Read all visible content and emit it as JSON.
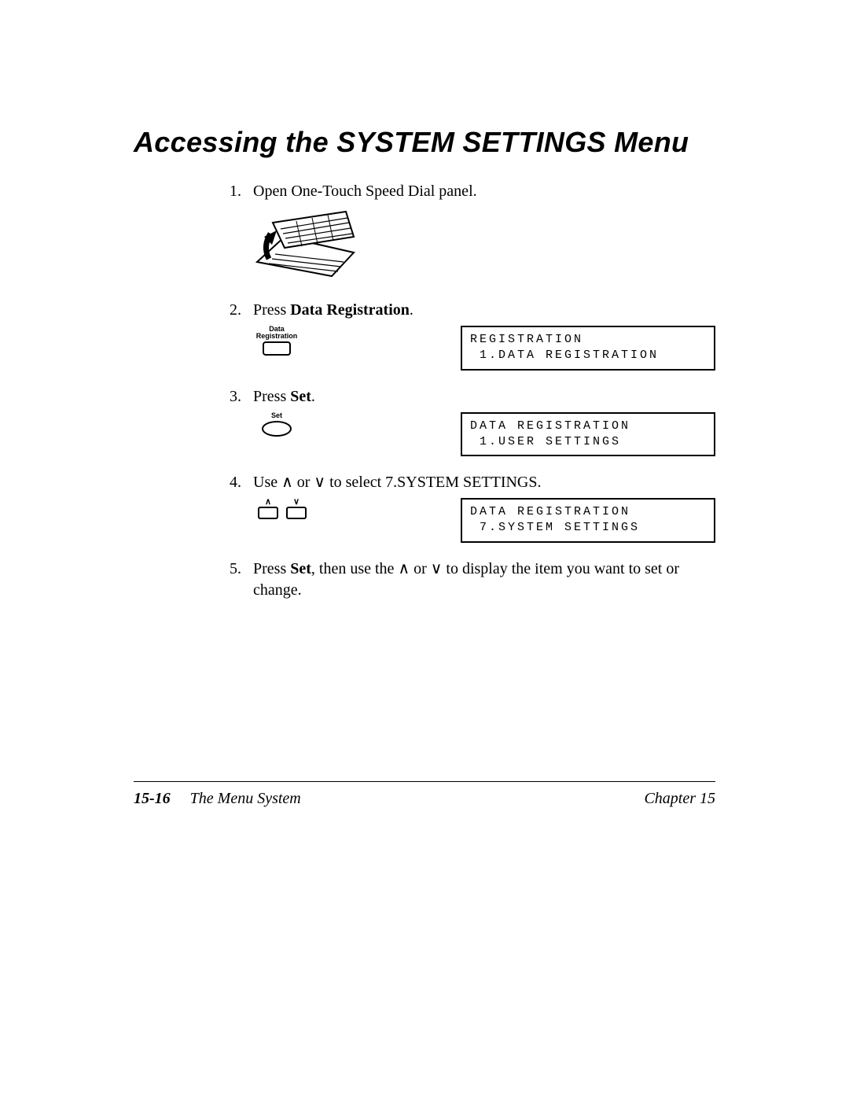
{
  "heading": "Accessing the SYSTEM SETTINGS Menu",
  "steps": {
    "s1": "Open One-Touch Speed Dial panel.",
    "s2_pre": "Press ",
    "s2_bold": "Data Registration",
    "s2_post": ".",
    "s2_btn_l1": "Data",
    "s2_btn_l2": "Registration",
    "s3_pre": "Press ",
    "s3_bold": "Set",
    "s3_post": ".",
    "s3_btn": "Set",
    "s4_pre": "Use ",
    "s4_up": "∧",
    "s4_mid": " or ",
    "s4_down": "∨",
    "s4_post": " to select 7.SYSTEM SETTINGS.",
    "s5_pre": "Press ",
    "s5_bold": "Set",
    "s5_mid1": ", then use the ",
    "s5_up": "∧",
    "s5_mid2": " or ",
    "s5_down": "∨",
    "s5_post": " to display the item you want to set or change."
  },
  "lcd": {
    "d1l1": "REGISTRATION",
    "d1l2": " 1.DATA REGISTRATION",
    "d2l1": "DATA REGISTRATION",
    "d2l2": " 1.USER SETTINGS",
    "d3l1": "DATA REGISTRATION",
    "d3l2": " 7.SYSTEM SETTINGS"
  },
  "footer": {
    "pagenum": "15-16",
    "section": "The Menu System",
    "chapter": "Chapter 15"
  }
}
